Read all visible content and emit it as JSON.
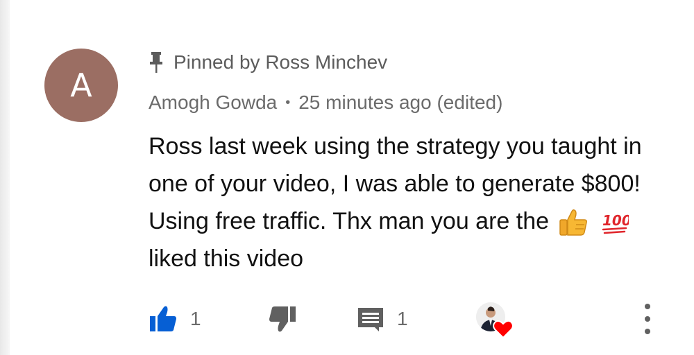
{
  "comment": {
    "avatar_letter": "A",
    "avatar_color": "#9b6e63",
    "pinned_label": "Pinned by Ross Minchev",
    "author": "Amogh Gowda",
    "separator": "•",
    "timestamp": "25 minutes ago (edited)",
    "text_part1": "Ross last week using the strategy you taught in one of your video, I was able to generate $800! Using free traffic. Thx man you are the",
    "emoji_1": "thumbs-up-emoji",
    "emoji_2": "hundred-points-emoji",
    "text_part2": "liked this video"
  },
  "actions": {
    "like_count": "1",
    "reply_count": "1",
    "like_color": "#065fd4",
    "icon_color": "#606060",
    "heart_color": "#ff0000",
    "creator_hearted": true
  }
}
